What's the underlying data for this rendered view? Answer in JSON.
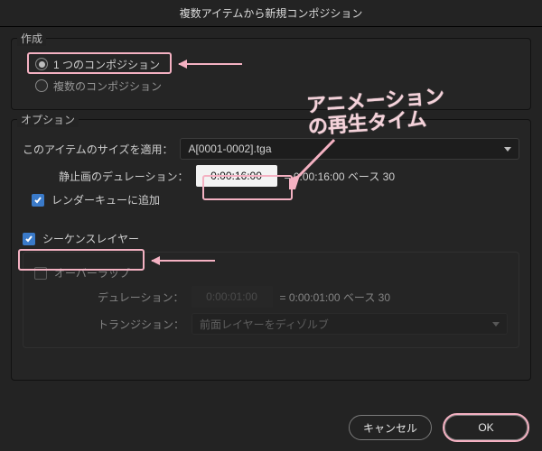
{
  "title": "複数アイテムから新規コンポジション",
  "create": {
    "section": "作成",
    "single": "1 つのコンポジション",
    "multiple": "複数のコンポジション"
  },
  "options": {
    "section": "オプション",
    "applySizeLabel": "このアイテムのサイズを適用：",
    "applySizeValue": "A[0001-0002].tga",
    "stillDurationLabel": "静止画のデュレーション：",
    "stillDurationValue": "0:00:16:00",
    "stillDurationEquals": "= 0:00:16:00  ベース 30",
    "addToRenderQueue": "レンダーキューに追加",
    "sequenceLayers": "シーケンスレイヤー",
    "overlap": "オーバーラップ",
    "overlapDurationLabel": "デュレーション：",
    "overlapDurationValue": "0:00:01:00",
    "overlapDurationEquals": "= 0:00:01:00  ベース 30",
    "transitionLabel": "トランジション：",
    "transitionValue": "前面レイヤーをディゾルブ"
  },
  "buttons": {
    "cancel": "キャンセル",
    "ok": "OK"
  },
  "annotation": {
    "line1": "アニメーション",
    "line2": "の再生タイム"
  }
}
